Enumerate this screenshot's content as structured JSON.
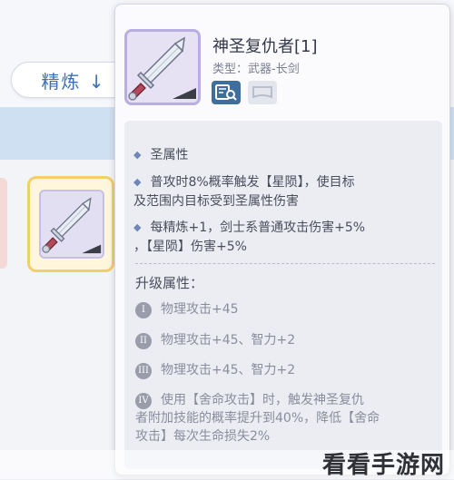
{
  "background": {
    "refine_label": "精炼 ↓"
  },
  "item": {
    "name": "神圣复仇者[1]",
    "type": "类型：武器-长剑"
  },
  "effects": {
    "holy_attribute": "圣属性",
    "effect_1_line1": "普攻时8%概率触发【星陨】，使目标",
    "effect_1_line2": "及范围内目标受到圣属性伤害",
    "effect_2_line1": "每精炼+1，剑士系普通攻击伤害+5%",
    "effect_2_line2": "，【星陨】伤害+5%"
  },
  "upgrade": {
    "title": "升级属性：",
    "tiers": [
      {
        "numeral": "I",
        "text": "物理攻击+45"
      },
      {
        "numeral": "II",
        "text": "物理攻击+45、智力+2"
      },
      {
        "numeral": "III",
        "text": "物理攻击+45、智力+2"
      },
      {
        "numeral": "IV",
        "text_line1": "使用【舍命攻击】时，触发神圣复仇",
        "text_line2": "者附加技能的概率提升到40%，降低【舍命",
        "text_line3": "攻击】每次生命损失2%"
      }
    ]
  },
  "watermark": "看看手游网",
  "colors": {
    "accent_blue": "#3d6fb8",
    "slot_border": "#f1cf6a",
    "icon_border": "#b9aee0",
    "badge": "#3f6e9c"
  },
  "icons": [
    "sword-icon",
    "inspect-icon",
    "card-slot-icon",
    "diamond-bullet-icon",
    "down-arrow-icon"
  ]
}
